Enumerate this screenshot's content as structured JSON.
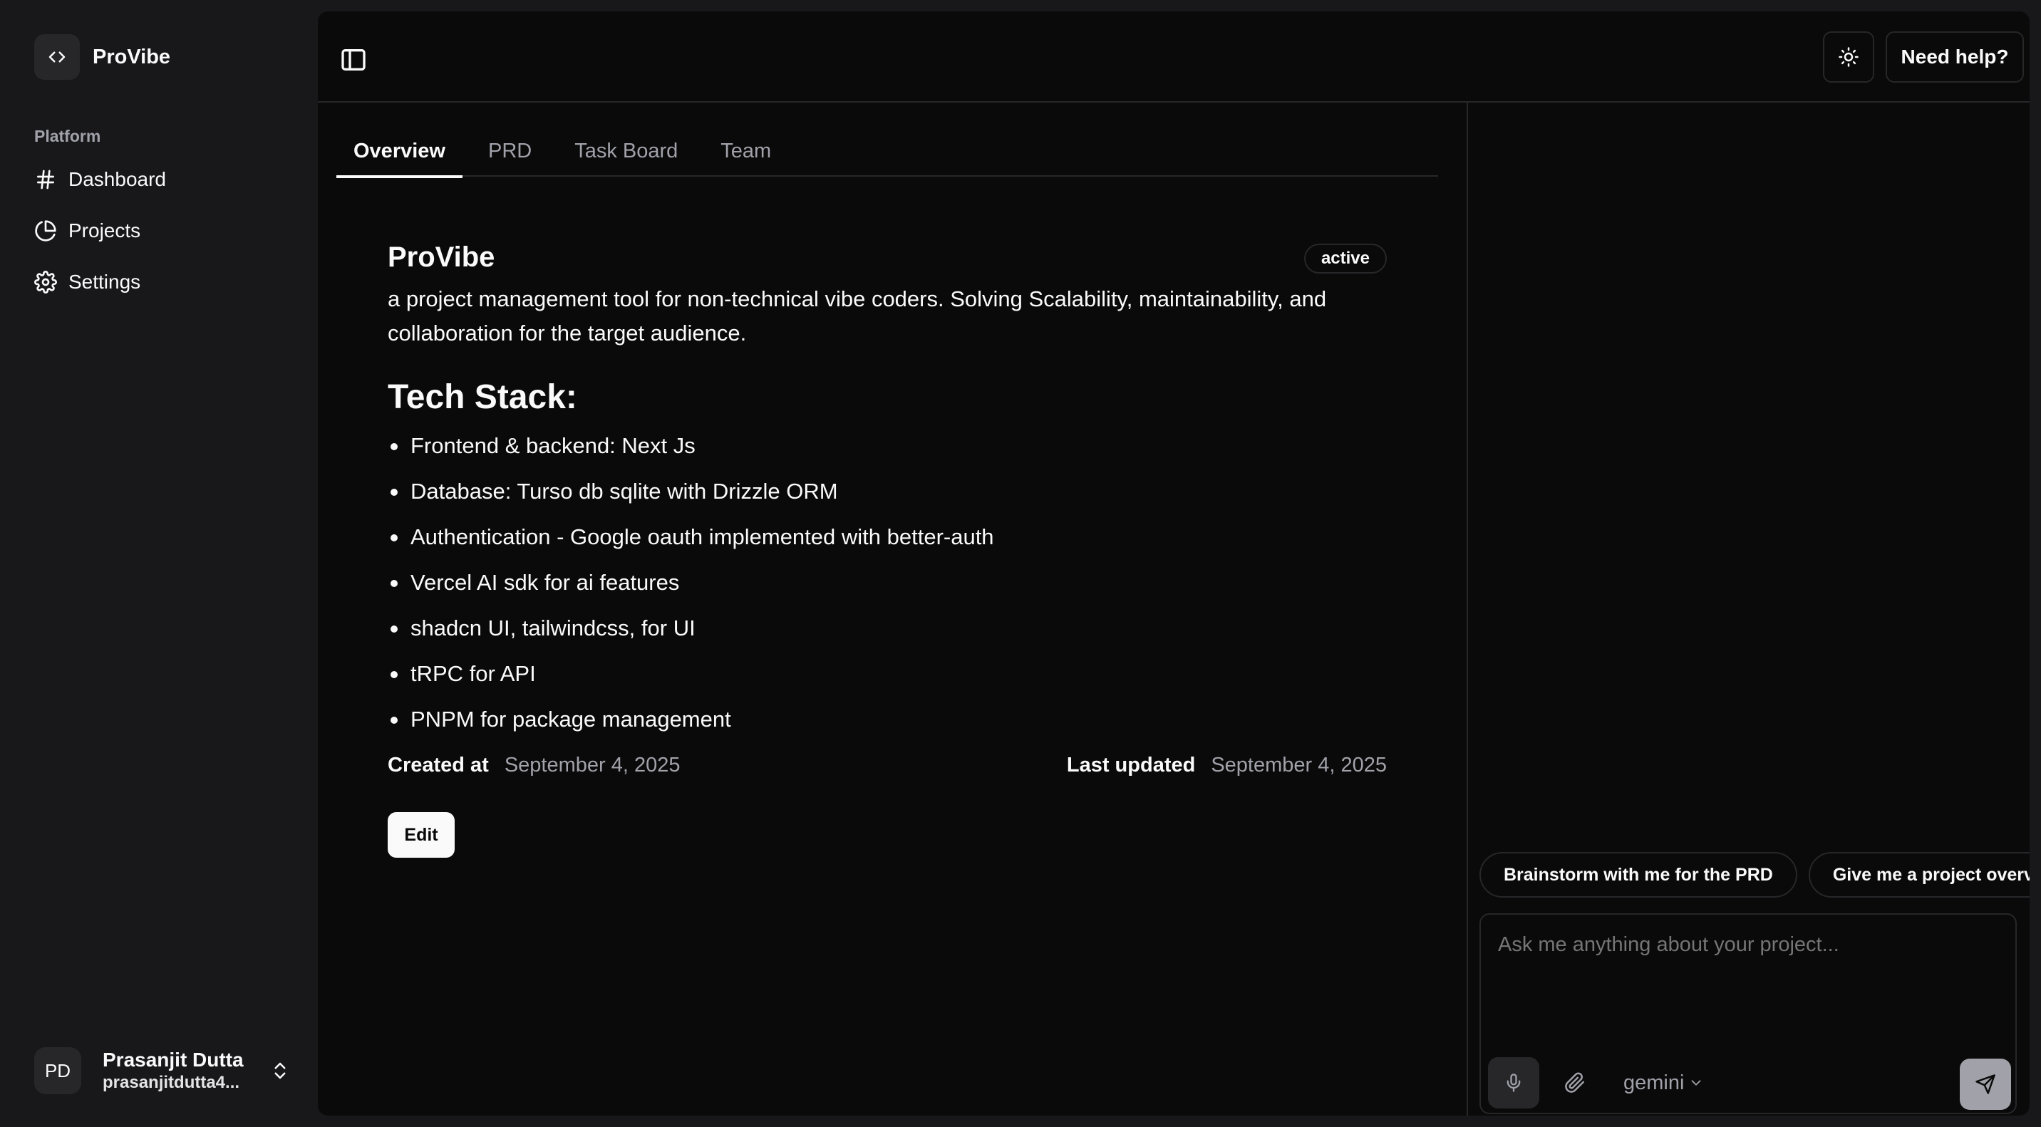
{
  "app": {
    "name": "ProVibe"
  },
  "sidebar": {
    "group_label": "Platform",
    "items": [
      {
        "label": "Dashboard",
        "icon": "hash-icon"
      },
      {
        "label": "Projects",
        "icon": "pie-chart-icon"
      },
      {
        "label": "Settings",
        "icon": "gear-icon"
      }
    ],
    "user": {
      "initials": "PD",
      "name": "Prasanjit Dutta",
      "email": "prasanjitdutta4..."
    }
  },
  "header": {
    "help_label": "Need help?"
  },
  "tabs": [
    {
      "label": "Overview",
      "active": true
    },
    {
      "label": "PRD",
      "active": false
    },
    {
      "label": "Task Board",
      "active": false
    },
    {
      "label": "Team",
      "active": false
    }
  ],
  "project": {
    "title": "ProVibe",
    "status": "active",
    "description": "a project management tool for non-technical vibe coders. Solving Scalability, maintainability, and collaboration for the target audience.",
    "tech_heading": "Tech Stack:",
    "tech_stack": [
      "Frontend & backend: Next Js",
      "Database: Turso db sqlite with Drizzle ORM",
      "Authentication - Google oauth implemented with better-auth",
      "Vercel AI sdk for ai features",
      "shadcn UI, tailwindcss, for UI",
      "tRPC for API",
      "PNPM for package management"
    ],
    "created_label": "Created at",
    "created_value": "September 4, 2025",
    "updated_label": "Last updated",
    "updated_value": "September 4, 2025",
    "edit_label": "Edit"
  },
  "chat": {
    "suggestions": [
      "Brainstorm with me for the PRD",
      "Give me a project overview"
    ],
    "placeholder": "Ask me anything about your project...",
    "model": "gemini"
  },
  "colors": {
    "background": "#0a0a0a",
    "sidebar": "#18181b",
    "border": "#27272a",
    "muted_text": "#a1a1aa",
    "primary": "#fafafa"
  }
}
